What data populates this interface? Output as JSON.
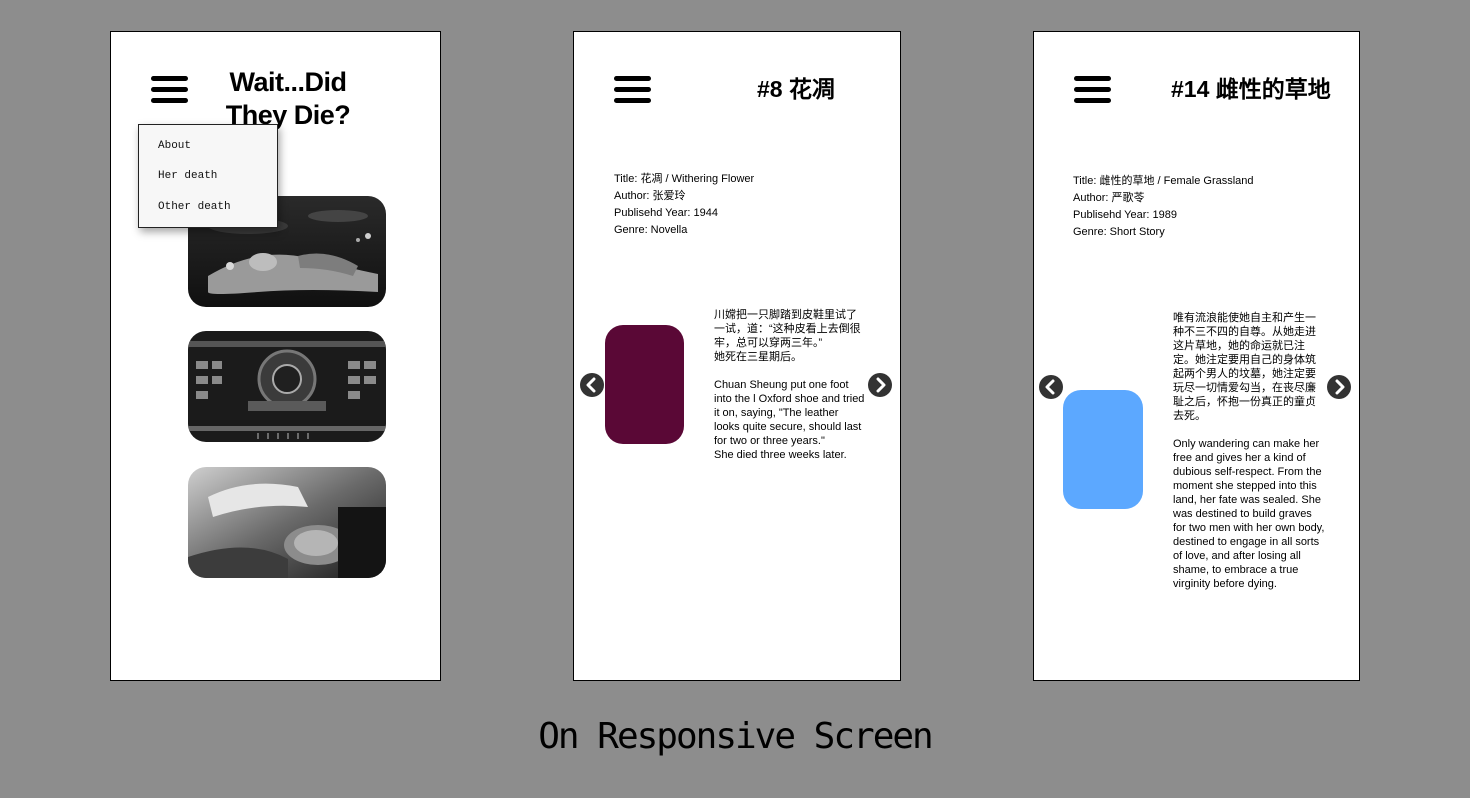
{
  "home": {
    "title": "Wait...Did They Die?",
    "menu": [
      "About",
      "Her death",
      "Other death"
    ]
  },
  "films": [
    {
      "heading": "#8 花凋",
      "title": "Title: 花凋 / Withering Flower",
      "author": "Author: 张爱玲",
      "year": "Publisehd Year: 1944",
      "genre": "Genre: Novella",
      "quote_zh": "川嫦把一只脚踏到皮鞋里试了一试，道：“这种皮看上去倒很牢，总可以穿两三年。”",
      "quote_zh_2": "她死在三星期后。",
      "quote_en": "Chuan Sheung put one foot into the l Oxford shoe and tried it on, saying, \"The leather looks quite secure, should last for two or three years.\"",
      "quote_en_2": "She died three weeks later.",
      "color": "#5a0836"
    },
    {
      "heading": "#14 雌性的草地",
      "title": "Title: 雌性的草地 / Female Grassland",
      "author": "Author: 严歌苓",
      "year": "Publisehd Year: 1989",
      "genre": "Genre: Short Story",
      "quote_zh": "唯有流浪能使她自主和产生一种不三不四的自尊。从她走进这片草地，她的命运就已注定。她注定要用自己的身体筑起两个男人的坟墓，她注定要玩尽一切情爱勾当，在丧尽廉耻之后，怀抱一份真正的童贞去死。",
      "quote_en": "Only wandering can make her free and gives her a kind of dubious self-respect. From the moment she stepped into this land, her fate was sealed. She was destined to build graves for two men with her own body, destined to engage in all sorts of love, and after losing all shame, to embrace a true virginity before dying.",
      "color": "#5ca8ff"
    }
  ],
  "caption": "On Responsive Screen"
}
